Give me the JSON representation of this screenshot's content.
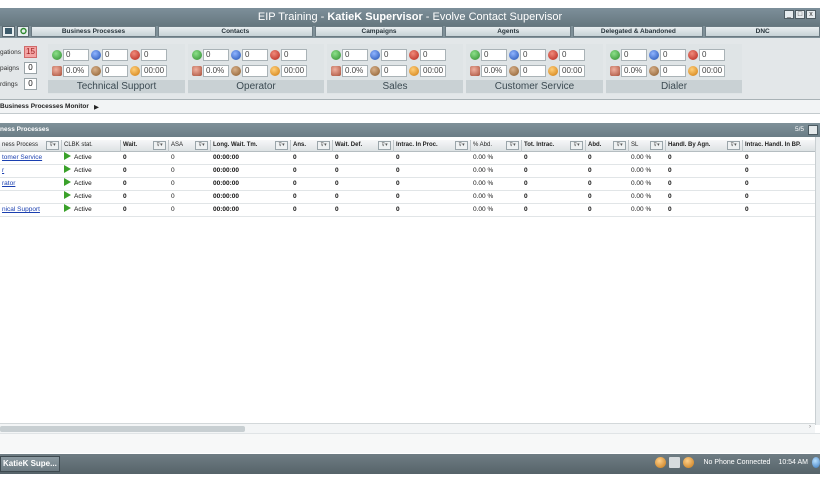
{
  "window": {
    "title_prefix": "EIP Training - ",
    "title_user": "KatieK Supervisor",
    "title_suffix": " - Evolve Contact Supervisor",
    "btn_min": "_",
    "btn_max": "□",
    "btn_close": "x"
  },
  "tabs": [
    "Business Processes",
    "Contacts",
    "Campaigns",
    "Agents",
    "Delegated & Abandoned",
    "DNC"
  ],
  "left_counts": [
    {
      "label": "gations",
      "value": "15"
    },
    {
      "label": "paigns",
      "value": "0"
    },
    {
      "label": "rdings",
      "value": "0"
    }
  ],
  "groups": [
    {
      "name": "Technical Support",
      "v": [
        "0",
        "0",
        "0",
        "0.0%",
        "0",
        "00:00"
      ]
    },
    {
      "name": "Operator",
      "v": [
        "0",
        "0",
        "0",
        "0.0%",
        "0",
        "00:00"
      ]
    },
    {
      "name": "Sales",
      "v": [
        "0",
        "0",
        "0",
        "0.0%",
        "0",
        "00:00"
      ]
    },
    {
      "name": "Customer Service",
      "v": [
        "0",
        "0",
        "0",
        "0.0%",
        "0",
        "00:00"
      ]
    },
    {
      "name": "Dialer",
      "v": [
        "0",
        "0",
        "0",
        "0.0%",
        "0",
        "00:00"
      ]
    }
  ],
  "monitor": {
    "title": "Business Processes Monitor",
    "arrow": "▶"
  },
  "panel": {
    "title": "ness Processes",
    "count": "5/5"
  },
  "columns": [
    "ness Process",
    "CLBK stat.",
    "Wait.",
    "ASA",
    "Long. Wait. Tm.",
    "Ans.",
    "Wait. Def.",
    "Intrac. In Proc.",
    "% Abd.",
    "Tot. Intrac.",
    "Abd.",
    "SL",
    "Handl. By Agn.",
    "Intrac. Handl. In BP."
  ],
  "filter_glyph": "⊽▾",
  "rows": [
    [
      "tomer Service",
      "Active",
      "0",
      "0",
      "00:00:00",
      "0",
      "0",
      "0",
      "0.00 %",
      "0",
      "0",
      "0.00 %",
      "0",
      "0"
    ],
    [
      "r",
      "Active",
      "0",
      "0",
      "00:00:00",
      "0",
      "0",
      "0",
      "0.00 %",
      "0",
      "0",
      "0.00 %",
      "0",
      "0"
    ],
    [
      "rator",
      "Active",
      "0",
      "0",
      "00:00:00",
      "0",
      "0",
      "0",
      "0.00 %",
      "0",
      "0",
      "0.00 %",
      "0",
      "0"
    ],
    [
      "",
      "Active",
      "0",
      "0",
      "00:00:00",
      "0",
      "0",
      "0",
      "0.00 %",
      "0",
      "0",
      "0.00 %",
      "0",
      "0"
    ],
    [
      "nical Support",
      "Active",
      "0",
      "0",
      "00:00:00",
      "0",
      "0",
      "0",
      "0.00 %",
      "0",
      "0",
      "0.00 %",
      "0",
      "0"
    ]
  ],
  "hscroll_arrow": "›",
  "taskbar": {
    "task_label": "KatieK Supe...",
    "status": "No Phone Connected",
    "clock": "10:54 AM"
  }
}
